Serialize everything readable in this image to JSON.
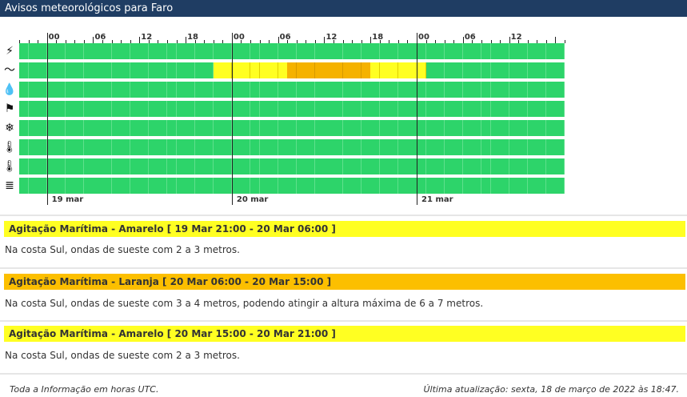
{
  "header": {
    "title": "Avisos meteorológicos para Faro"
  },
  "timeline": {
    "hour_labels": [
      "00",
      "06",
      "12",
      "18",
      "00",
      "06",
      "12",
      "18",
      "00",
      "06",
      "12"
    ],
    "day_labels": [
      "19 mar",
      "20 mar",
      "21 mar"
    ],
    "slots_per_row": 59,
    "rows": [
      {
        "icon": "lightning-icon",
        "glyph": "⚡",
        "segments": []
      },
      {
        "icon": "wave-icon",
        "glyph": "〜",
        "segments": [
          {
            "start": 21,
            "end": 29,
            "level": "yellow"
          },
          {
            "start": 29,
            "end": 38,
            "level": "orange"
          },
          {
            "start": 38,
            "end": 44,
            "level": "yellow"
          }
        ]
      },
      {
        "icon": "rain-icon",
        "glyph": "💧",
        "segments": []
      },
      {
        "icon": "wind-icon",
        "glyph": "⚑",
        "segments": []
      },
      {
        "icon": "snow-icon",
        "glyph": "❄",
        "segments": []
      },
      {
        "icon": "cold-thermometer-icon",
        "glyph": "🌡",
        "segments": []
      },
      {
        "icon": "hot-thermometer-icon",
        "glyph": "🌡",
        "segments": []
      },
      {
        "icon": "fog-icon",
        "glyph": "≣",
        "segments": []
      }
    ],
    "colors": {
      "green": "#2dd46a",
      "yellow": "#ffff22",
      "orange": "#f5b200"
    }
  },
  "warnings": [
    {
      "title": "Agitação Marítima - Amarelo [ 19 Mar 21:00 - 20 Mar 06:00 ]",
      "text": "Na costa Sul, ondas de sueste com 2 a 3 metros.",
      "color": "#ffff22"
    },
    {
      "title": "Agitação Marítima - Laranja [ 20 Mar 06:00 - 20 Mar 15:00 ]",
      "text": "Na costa Sul, ondas de sueste com 3 a 4 metros, podendo atingir a altura máxima de 6 a 7 metros.",
      "color": "#fcbf00"
    },
    {
      "title": "Agitação Marítima - Amarelo [ 20 Mar 15:00 - 20 Mar 21:00 ]",
      "text": "Na costa Sul, ondas de sueste com 2 a 3 metros.",
      "color": "#ffff22"
    }
  ],
  "footer": {
    "left": "Toda a Informação em horas UTC.",
    "right": "Última atualização: sexta, 18 de março de 2022 às 18:47."
  }
}
